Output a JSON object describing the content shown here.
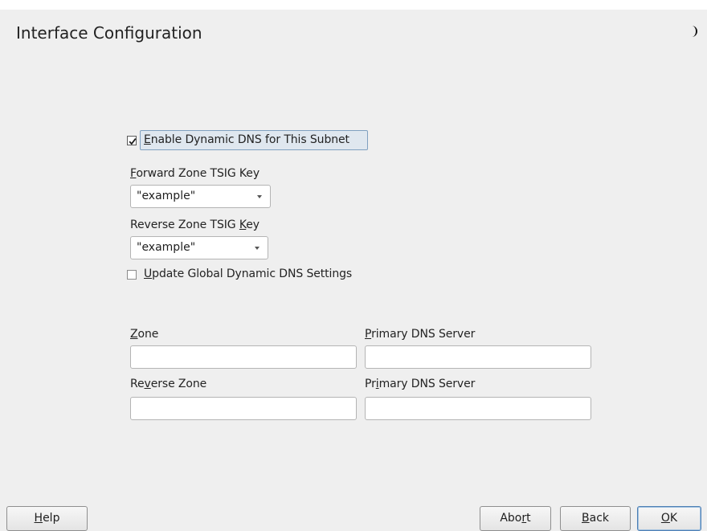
{
  "window": {
    "title": "Interface Configuration",
    "corner_icon": "moon-icon"
  },
  "dynamic_dns": {
    "enable_label_prefix": "",
    "enable_label_mnemonic": "E",
    "enable_label_rest": "nable Dynamic DNS for This Subnet",
    "enable_checked": true,
    "forward_key_label_mnemonic": "F",
    "forward_key_label_rest": "orward Zone TSIG Key",
    "forward_key_value": "\"example\"",
    "reverse_key_label_prefix": "Reverse Zone TSIG ",
    "reverse_key_label_mnemonic": "K",
    "reverse_key_label_rest": "ey",
    "reverse_key_value": "\"example\"",
    "update_global_label_mnemonic": "U",
    "update_global_label_rest": "pdate Global Dynamic DNS Settings",
    "update_global_checked": false
  },
  "zones": {
    "zone_label_mnemonic": "Z",
    "zone_label_rest": "one",
    "zone_value": "",
    "zone_primary_label_mnemonic": "P",
    "zone_primary_label_rest": "rimary DNS Server",
    "zone_primary_value": "",
    "reverse_label_prefix": "Re",
    "reverse_label_mnemonic": "v",
    "reverse_label_rest": "erse Zone",
    "reverse_value": "",
    "reverse_primary_label_prefix": "Pr",
    "reverse_primary_label_mnemonic": "i",
    "reverse_primary_label_rest": "mary DNS Server",
    "reverse_primary_value": ""
  },
  "buttons": {
    "help_mnemonic": "H",
    "help_rest": "elp",
    "abort_prefix": "Abo",
    "abort_mnemonic": "r",
    "abort_rest": "t",
    "back_mnemonic": "B",
    "back_rest": "ack",
    "ok_mnemonic": "O",
    "ok_rest": "K"
  },
  "colors": {
    "background": "#efefef",
    "focus_highlight": "#dfe7ef",
    "default_button_border": "#4d7fb4"
  }
}
